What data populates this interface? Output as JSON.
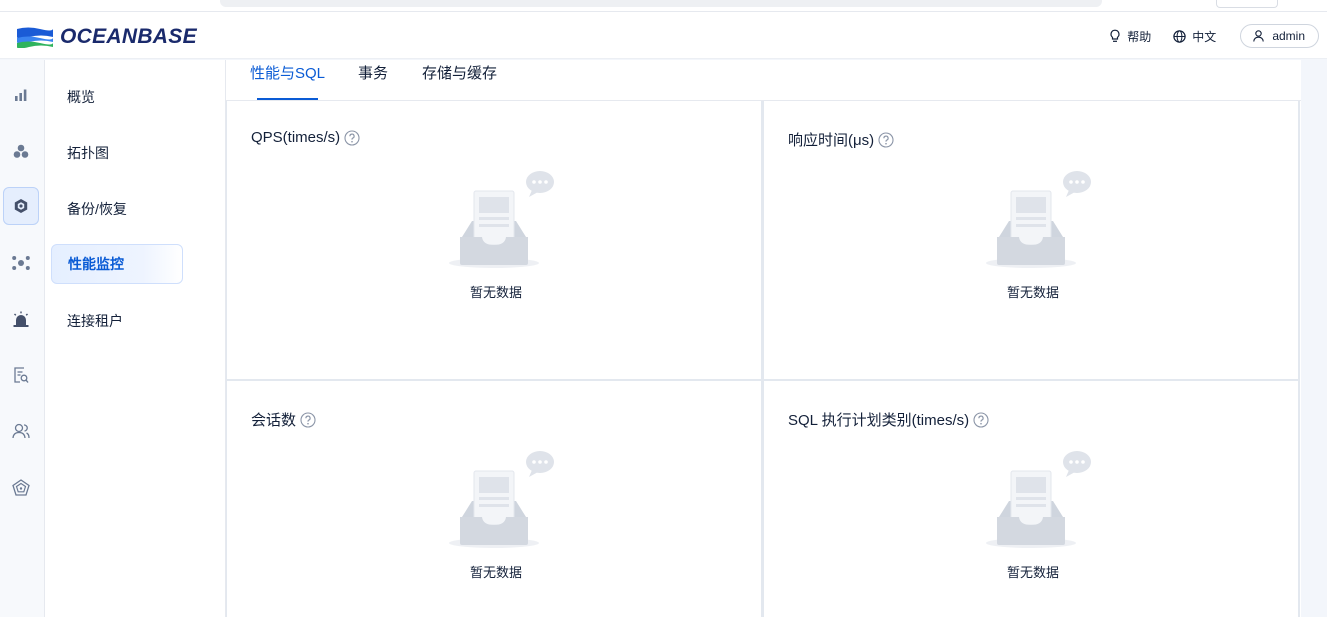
{
  "brand": {
    "name": "OCEANBASE",
    "colors": {
      "blue": "#1a5bd6",
      "green": "#2fb35d",
      "navy": "#1a2a6c"
    }
  },
  "header": {
    "help_label": "帮助",
    "help_icon": "lightbulb-icon",
    "lang_label": "中文",
    "lang_icon": "globe-icon",
    "user_label": "admin",
    "user_icon": "user-icon"
  },
  "iconbar": {
    "items": [
      {
        "icon": "bar-chart-icon",
        "active": false
      },
      {
        "icon": "cluster-icon",
        "active": false
      },
      {
        "icon": "hexagon-icon",
        "active": true
      },
      {
        "icon": "nodes-icon",
        "active": false
      },
      {
        "icon": "alarm-icon",
        "active": false
      },
      {
        "icon": "document-search-icon",
        "active": false
      },
      {
        "icon": "users-icon",
        "active": false
      },
      {
        "icon": "polygon-icon",
        "active": false
      }
    ]
  },
  "submenu": {
    "items": [
      {
        "label": "概览",
        "active": false
      },
      {
        "label": "拓扑图",
        "active": false
      },
      {
        "label": "备份/恢复",
        "active": false
      },
      {
        "label": "性能监控",
        "active": true
      },
      {
        "label": "连接租户",
        "active": false
      }
    ]
  },
  "tabs": [
    {
      "label": "性能与SQL",
      "active": true
    },
    {
      "label": "事务",
      "active": false
    },
    {
      "label": "存储与缓存",
      "active": false
    }
  ],
  "cards": [
    {
      "title": "QPS(times/s)",
      "empty_text": "暂无数据"
    },
    {
      "title": "响应时间(μs)",
      "empty_text": "暂无数据"
    },
    {
      "title": "会话数",
      "empty_text": "暂无数据"
    },
    {
      "title": "SQL 执行计划类别(times/s)",
      "empty_text": "暂无数据"
    }
  ]
}
